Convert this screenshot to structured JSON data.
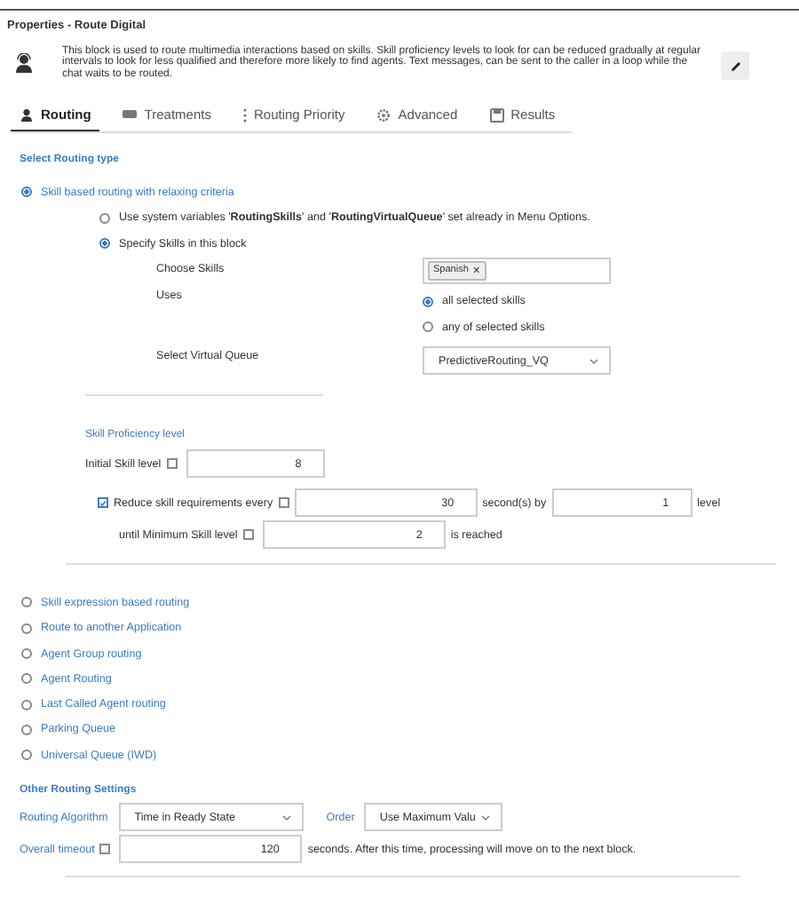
{
  "panel": {
    "title": "Properties - Route Digital",
    "description": "This block is used to route multimedia interactions based on skills. Skill proficiency levels to look for can be reduced gradually at regular intervals to look for less qualified and therefore more likely to find agents. Text messages, can be sent to the caller in a loop while the chat waits to be routed."
  },
  "tabs": [
    {
      "label": "Routing",
      "kind": "person",
      "selected": true
    },
    {
      "label": "Treatments",
      "kind": "chat",
      "selected": false
    },
    {
      "label": "Routing Priority",
      "kind": "dots",
      "selected": false
    },
    {
      "label": "Advanced",
      "kind": "gear",
      "selected": false
    },
    {
      "label": "Results",
      "kind": "save",
      "selected": false
    }
  ],
  "routing_heading": "Select Routing type",
  "routing_types": [
    {
      "label": "Skill based routing with relaxing criteria",
      "selected": true
    },
    {
      "label": "Skill expression based routing",
      "selected": false
    },
    {
      "label": "Route to another Application",
      "selected": false
    },
    {
      "label": "Agent Group routing",
      "selected": false
    },
    {
      "label": "Agent Routing",
      "selected": false
    },
    {
      "label": "Last Called Agent routing",
      "selected": false
    },
    {
      "label": "Parking Queue",
      "selected": false
    },
    {
      "label": "Universal Queue (IWD)",
      "selected": false
    }
  ],
  "skill_routing": {
    "source_options": [
      {
        "label": "Use system variables '**RoutingSkills**' and '**RoutingVirtualQueue**' set already in Menu Options.",
        "selected": false
      },
      {
        "label": "Specify Skills in this block",
        "selected": true
      }
    ],
    "choose_skills_label": "Choose Skills",
    "skills": [
      {
        "label": "Spanish",
        "remove": "✕"
      }
    ],
    "uses_label": "Uses",
    "uses_options": [
      {
        "label": "all selected skills",
        "selected": true
      },
      {
        "label": "any of selected skills",
        "selected": false
      }
    ],
    "queue_label": "Select Virtual Queue",
    "queue_value": "PredictiveRouting_VQ"
  },
  "proficiency": {
    "heading": "Skill Proficiency level",
    "initial_label": "Initial Skill level",
    "initial_checked": false,
    "initial_value": "8",
    "reduce_checked": true,
    "reduce_label": "Reduce skill requirements every",
    "interval_checked": false,
    "interval_value": "30",
    "by_label": "second(s) by",
    "step_value": "1",
    "unit_label": "level",
    "minimum_label": "until Minimum Skill level",
    "minimum_checked": false,
    "minimum_value": "2",
    "minimum_suffix": "is reached"
  },
  "other_settings": {
    "heading": "Other Routing Settings",
    "algorithm_label": "Routing Algorithm",
    "algorithm_value": "Time in Ready State",
    "order_label": "Order",
    "order_value": "Use Maximum Valu",
    "timeout_label": "Overall timeout",
    "timeout_checked": false,
    "timeout_value": "120",
    "timeout_note": "seconds. After this time, processing will move on to the next block."
  }
}
